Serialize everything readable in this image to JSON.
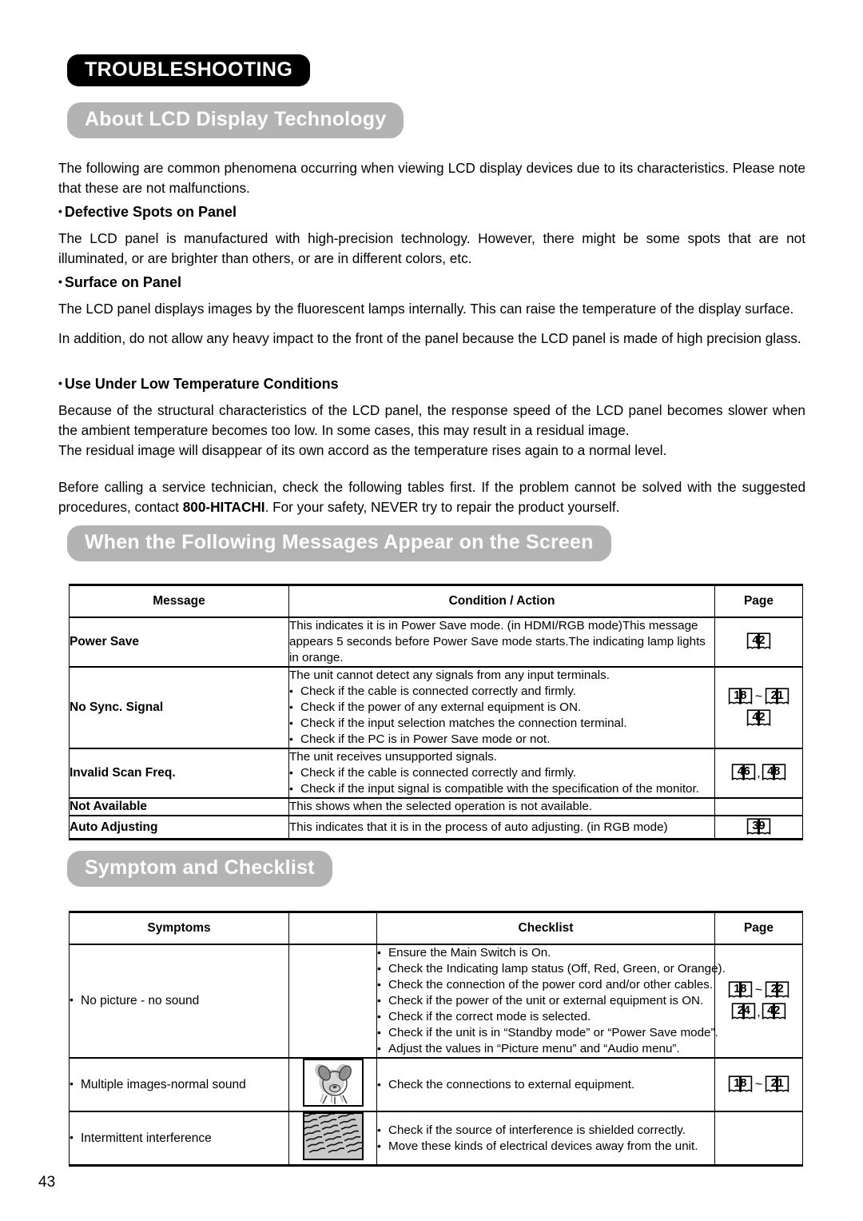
{
  "document": {
    "chapter_tab": "TROUBLESHOOTING",
    "folio": "43"
  },
  "sections": {
    "about": {
      "title": "About LCD Display Technology",
      "intro": "The following are common phenomena occurring when viewing LCD display devices due to its characteristics. Please note that these are not malfunctions.",
      "subsections": [
        {
          "heading": "Defective Spots on Panel",
          "body": "The LCD panel is manufactured with high-precision technology. However, there might be some spots that are not illuminated, or are brighter than others, or are in different colors, etc."
        },
        {
          "heading": "Surface on Panel",
          "body_1": "The LCD panel displays images by the fluorescent lamps internally. This can raise the temperature of the display surface.",
          "body_2": "In addition, do not allow any heavy impact to the front of the panel because the LCD panel is made of high precision glass."
        },
        {
          "heading": "Use Under Low Temperature Conditions",
          "body_1": "Because of the structural characteristics of the LCD panel, the response speed of the LCD panel becomes slower when the ambient temperature becomes too low. In some cases, this may result in a residual image.",
          "body_2": "The residual image will disappear of its own accord as the temperature rises again to a normal level."
        }
      ],
      "service_note_before": "Before calling a service technician, check the following tables first. If the problem cannot be solved with the suggested procedures, contact ",
      "service_note_phone": "800-HITACHI",
      "service_note_after": ". For your safety, NEVER try to repair the product yourself."
    },
    "messages": {
      "title": "When the Following Messages Appear on the Screen",
      "columns": [
        "Message",
        "Condition / Action",
        "Page"
      ],
      "rows": [
        {
          "message": "Power Save",
          "lines": [
            "This indicates it is in Power Save mode. (in HDMI/RGB mode)",
            "This message appears 5 seconds before Power Save mode starts.",
            "The indicating lamp lights in orange."
          ],
          "bullets": [],
          "pages": [
            [
              "42"
            ]
          ]
        },
        {
          "message": "No Sync. Signal",
          "lines": [
            "The unit cannot detect any signals from any input terminals."
          ],
          "bullets": [
            "Check if the cable is connected correctly and firmly.",
            "Check if the power of any external equipment is ON.",
            "Check if the input selection matches the connection terminal.",
            "Check if the PC is in Power Save mode or not."
          ],
          "pages": [
            [
              "18",
              "~",
              "21"
            ],
            [
              "42"
            ]
          ]
        },
        {
          "message": "Invalid Scan Freq.",
          "lines": [
            "The unit receives unsupported signals."
          ],
          "bullets": [
            "Check if the cable is connected correctly and firmly.",
            "Check if the input signal is compatible with the specification of the monitor."
          ],
          "pages": [
            [
              "46",
              ",",
              "48"
            ]
          ]
        },
        {
          "message": "Not Available",
          "lines": [
            "This shows when the selected operation is not available."
          ],
          "bullets": [],
          "pages": []
        },
        {
          "message": "Auto Adjusting",
          "lines": [
            "This indicates that it is in the process of auto adjusting. (in RGB mode)"
          ],
          "bullets": [],
          "pages": [
            [
              "39"
            ]
          ]
        }
      ]
    },
    "symptom": {
      "title": "Symptom and Checklist",
      "columns": [
        "Symptoms",
        "",
        "Checklist",
        "Page"
      ],
      "rows": [
        {
          "symptom": "No picture - no sound",
          "picture": "",
          "checklist": [
            "Ensure the Main Switch is On.",
            "Check the Indicating lamp status (Off, Red, Green, or Orange).",
            "Check the connection of the power cord and/or other cables.",
            "Check if the power of the unit or external equipment is ON.",
            "Check if the correct mode is selected.",
            "Check if the unit is in “Standby mode” or “Power Save mode”.",
            "Adjust the values in “Picture menu” and “Audio menu”."
          ],
          "pages": [
            [
              "18",
              "~",
              "22"
            ],
            [
              "24",
              ",",
              "42"
            ]
          ]
        },
        {
          "symptom": "Multiple images-normal sound",
          "picture": "ghost-dog-image",
          "checklist": [
            "Check the connections to external equipment."
          ],
          "pages": [
            [
              "18",
              "~",
              "21"
            ]
          ]
        },
        {
          "symptom": "Intermittent interference",
          "picture": "interference-pattern-image",
          "checklist": [
            "Check if the source of interference is shielded correctly.",
            "Move these kinds of electrical devices away from the unit."
          ],
          "pages": []
        }
      ]
    }
  },
  "colors": {
    "chapter_tab_bg": "#000000",
    "section_bar_bg": "#b3b3b3",
    "text": "#000000",
    "interference_bg": "#c9c9c9"
  }
}
